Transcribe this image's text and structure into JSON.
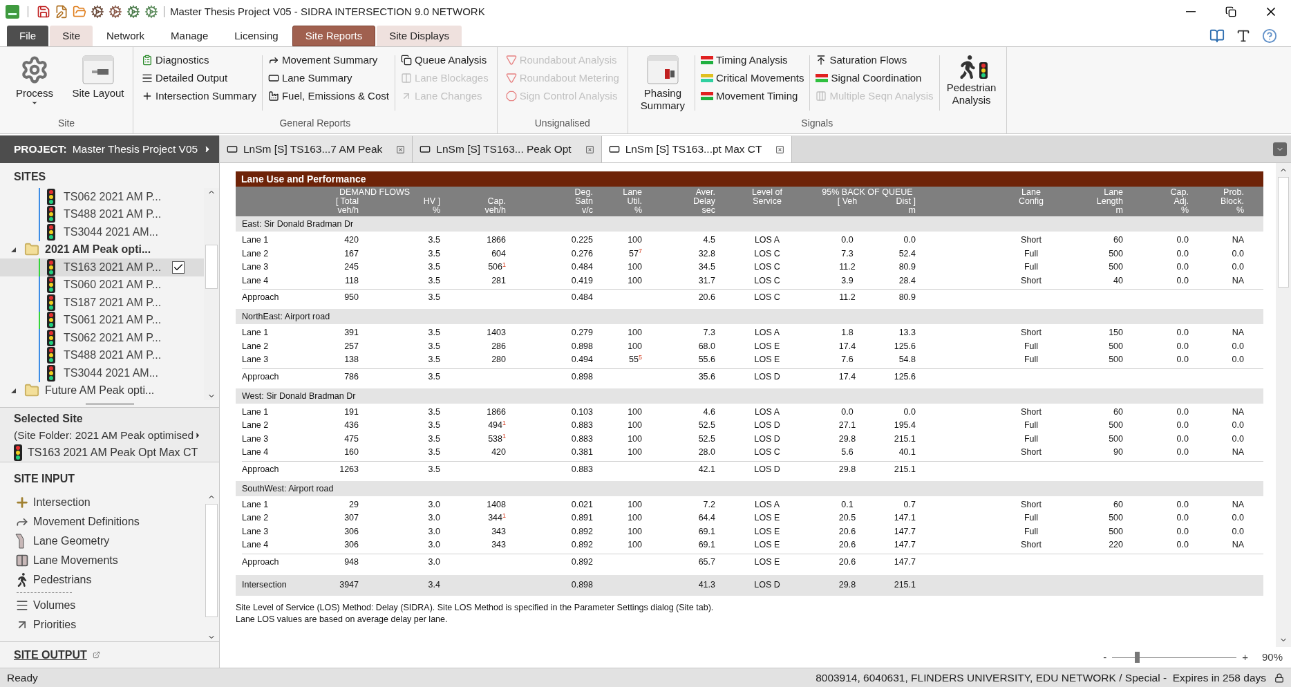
{
  "window": {
    "title": "Master Thesis Project V05 - SIDRA INTERSECTION 9.0 NETWORK"
  },
  "ribbon_tabs": [
    {
      "label": "File",
      "kind": "file",
      "selected": false
    },
    {
      "label": "Site",
      "kind": "contextual",
      "selected": false
    },
    {
      "label": "Network",
      "kind": "plain",
      "selected": false
    },
    {
      "label": "Manage",
      "kind": "plain",
      "selected": false
    },
    {
      "label": "Licensing",
      "kind": "plain",
      "selected": false
    },
    {
      "label": "Site Reports",
      "kind": "contextual",
      "selected": true
    },
    {
      "label": "Site Displays",
      "kind": "contextual",
      "selected": false
    }
  ],
  "ribbon_groups": [
    {
      "label": "Site",
      "entries": [
        {
          "kind": "large",
          "label": "Process",
          "dropdown": true,
          "disabled": false
        },
        {
          "kind": "large",
          "label": "Site Layout",
          "dropdown": false,
          "disabled": false
        }
      ]
    },
    {
      "label": "General Reports",
      "entries": [
        {
          "kind": "stack",
          "items": [
            {
              "label": "Diagnostics",
              "disabled": false
            },
            {
              "label": "Detailed Output",
              "disabled": false
            },
            {
              "label": "Intersection Summary",
              "disabled": false
            }
          ]
        },
        {
          "kind": "stack",
          "items": [
            {
              "label": "Movement Summary",
              "disabled": false
            },
            {
              "label": "Lane Summary",
              "disabled": false
            },
            {
              "label": "Fuel, Emissions & Cost",
              "disabled": false
            }
          ]
        },
        {
          "kind": "stack",
          "items": [
            {
              "label": "Queue Analysis",
              "disabled": false
            },
            {
              "label": "Lane Blockages",
              "disabled": true
            },
            {
              "label": "Lane Changes",
              "disabled": true
            }
          ]
        }
      ]
    },
    {
      "label": "Unsignalised",
      "entries": [
        {
          "kind": "stack",
          "items": [
            {
              "label": "Roundabout Analysis",
              "disabled": true
            },
            {
              "label": "Roundabout Metering",
              "disabled": true
            },
            {
              "label": "Sign Control Analysis",
              "disabled": true
            }
          ]
        }
      ]
    },
    {
      "label": "Signals",
      "entries": [
        {
          "kind": "large",
          "label": "Phasing Summary",
          "dropdown": false,
          "disabled": false
        },
        {
          "kind": "stack",
          "items": [
            {
              "label": "Timing Analysis",
              "disabled": false
            },
            {
              "label": "Critical Movements",
              "disabled": false
            },
            {
              "label": "Movement Timing",
              "disabled": false
            }
          ]
        },
        {
          "kind": "stack",
          "items": [
            {
              "label": "Saturation Flows",
              "disabled": false
            },
            {
              "label": "Signal Coordination",
              "disabled": false
            },
            {
              "label": "Multiple Seqn Analysis",
              "disabled": true
            }
          ]
        },
        {
          "kind": "large",
          "label": "Pedestrian Analysis",
          "dropdown": false,
          "disabled": false
        }
      ]
    }
  ],
  "project": {
    "label": "PROJECT:",
    "name": "Master Thesis Project V05"
  },
  "sites": {
    "title": "SITES",
    "items": [
      {
        "kind": "site",
        "label": "TS062 2021 AM P...",
        "color": "#3c8ce6",
        "selected": false
      },
      {
        "kind": "site",
        "label": "TS488 2021 AM P...",
        "color": "#3c8ce6",
        "selected": false
      },
      {
        "kind": "site",
        "label": "TS3044 2021 AM...",
        "color": "#3c8ce6",
        "selected": false
      },
      {
        "kind": "folder",
        "label": "2021 AM Peak opti...",
        "expanded": true,
        "active": true,
        "children": [
          {
            "kind": "site",
            "label": "TS163 2021 AM P...",
            "color": "#35d43a",
            "selected": true
          },
          {
            "kind": "site",
            "label": "TS060 2021 AM P...",
            "color": "#3c8ce6",
            "selected": false
          },
          {
            "kind": "site",
            "label": "TS187 2021 AM P...",
            "color": "#3c8ce6",
            "selected": false
          },
          {
            "kind": "site",
            "label": "TS061 2021 AM P...",
            "color": "#35d43a",
            "selected": false
          },
          {
            "kind": "site",
            "label": "TS062 2021 AM P...",
            "color": "#3c8ce6",
            "selected": false
          },
          {
            "kind": "site",
            "label": "TS488 2021 AM P...",
            "color": "#3c8ce6",
            "selected": false
          },
          {
            "kind": "site",
            "label": "TS3044 2021 AM...",
            "color": "#3c8ce6",
            "selected": false
          }
        ]
      },
      {
        "kind": "folder",
        "label": "Future AM Peak opti...",
        "expanded": true,
        "active": false
      }
    ]
  },
  "selected_site": {
    "title": "Selected Site",
    "folder": "(Site Folder: 2021 AM Peak optimised",
    "site": "TS163 2021 AM Peak Opt Max CT"
  },
  "site_input": {
    "title": "SITE INPUT",
    "items": [
      {
        "kind": "item",
        "label": "Intersection"
      },
      {
        "kind": "item",
        "label": "Movement Definitions"
      },
      {
        "kind": "item",
        "label": "Lane Geometry"
      },
      {
        "kind": "item",
        "label": "Lane Movements"
      },
      {
        "kind": "item",
        "label": "Pedestrians"
      },
      {
        "kind": "separator"
      },
      {
        "kind": "item",
        "label": "Volumes"
      },
      {
        "kind": "item",
        "label": "Priorities"
      }
    ]
  },
  "site_output": {
    "label": "SITE OUTPUT"
  },
  "document_tabs": [
    {
      "label": "LnSm [S] TS163...7 AM Peak",
      "selected": false
    },
    {
      "label": "LnSm [S] TS163... Peak Opt",
      "selected": false
    },
    {
      "label": "LnSm [S] TS163...pt Max CT",
      "selected": true
    }
  ],
  "report": {
    "title": "Lane Use and Performance",
    "header": [
      {
        "kind": "column"
      },
      {
        "kind": "group",
        "label": "DEMAND FLOWS",
        "columns": [
          {
            "mid": "[ Total",
            "bottom": "veh/h"
          },
          {
            "mid": "HV ]",
            "bottom": "%"
          }
        ]
      },
      {
        "kind": "column",
        "mid": "Cap.",
        "bottom": "veh/h"
      },
      {
        "kind": "column",
        "top": "Deg.",
        "mid": "Satn",
        "bottom": "v/c"
      },
      {
        "kind": "column",
        "top": "Lane",
        "mid": "Util.",
        "bottom": "%"
      },
      {
        "kind": "column",
        "top": "Aver.",
        "mid": "Delay",
        "bottom": "sec"
      },
      {
        "kind": "column",
        "top": "Level of",
        "mid": "Service"
      },
      {
        "kind": "group",
        "label": "95% BACK OF QUEUE",
        "columns": [
          {
            "mid": "[ Veh"
          },
          {
            "mid": "Dist ]",
            "bottom": "m"
          }
        ]
      },
      {
        "kind": "column",
        "top": "Lane",
        "mid": "Config"
      },
      {
        "kind": "column",
        "top": "Lane",
        "mid": "Length",
        "bottom": "m"
      },
      {
        "kind": "column",
        "top": "Cap.",
        "mid": "Adj.",
        "bottom": "%"
      },
      {
        "kind": "column",
        "top": "Prob.",
        "mid": "Block.",
        "bottom": "%"
      }
    ],
    "sections": [
      {
        "title": "East: Sir Donald Bradman Dr",
        "rows": [
          {
            "kind": "lane",
            "cells": [
              "Lane 1",
              "420",
              "3.5",
              "1866",
              "0.225",
              "100",
              "4.5",
              "LOS A",
              "0.0",
              "0.0",
              "Short",
              "60",
              "0.0",
              "NA"
            ]
          },
          {
            "kind": "lane",
            "cells": [
              "Lane 2",
              "167",
              "3.5",
              "604",
              "0.276",
              "57$^{7}$",
              "32.8",
              "LOS C",
              "7.3",
              "52.4",
              "Full",
              "500",
              "0.0",
              "0.0"
            ]
          },
          {
            "kind": "lane",
            "cells": [
              "Lane 3",
              "245",
              "3.5",
              "506$^{1}$",
              "0.484",
              "100",
              "34.5",
              "LOS C",
              "11.2",
              "80.9",
              "Full",
              "500",
              "0.0",
              "0.0"
            ]
          },
          {
            "kind": "lane",
            "cells": [
              "Lane 4",
              "118",
              "3.5",
              "281",
              "0.419",
              "100",
              "31.7",
              "LOS C",
              "3.9",
              "28.4",
              "Short",
              "40",
              "0.0",
              "NA"
            ]
          },
          {
            "kind": "approach",
            "cells": [
              "Approach",
              "950",
              "3.5",
              null,
              "0.484",
              null,
              "20.6",
              "LOS C",
              "11.2",
              "80.9"
            ]
          }
        ]
      },
      {
        "title": "NorthEast: Airport road",
        "rows": [
          {
            "kind": "lane",
            "cells": [
              "Lane 1",
              "391",
              "3.5",
              "1403",
              "0.279",
              "100",
              "7.3",
              "LOS A",
              "1.8",
              "13.3",
              "Short",
              "150",
              "0.0",
              "NA"
            ]
          },
          {
            "kind": "lane",
            "cells": [
              "Lane 2",
              "257",
              "3.5",
              "286",
              "0.898",
              "100",
              "68.0",
              "LOS E",
              "17.4",
              "125.6",
              "Full",
              "500",
              "0.0",
              "0.0"
            ]
          },
          {
            "kind": "lane",
            "cells": [
              "Lane 3",
              "138",
              "3.5",
              "280",
              "0.494",
              "55$^{5}$",
              "55.6",
              "LOS E",
              "7.6",
              "54.8",
              "Full",
              "500",
              "0.0",
              "0.0"
            ]
          },
          {
            "kind": "approach",
            "cells": [
              "Approach",
              "786",
              "3.5",
              null,
              "0.898",
              null,
              "35.6",
              "LOS D",
              "17.4",
              "125.6"
            ]
          }
        ]
      },
      {
        "title": "West: Sir Donald Bradman Dr",
        "rows": [
          {
            "kind": "lane",
            "cells": [
              "Lane 1",
              "191",
              "3.5",
              "1866",
              "0.103",
              "100",
              "4.6",
              "LOS A",
              "0.0",
              "0.0",
              "Short",
              "60",
              "0.0",
              "NA"
            ]
          },
          {
            "kind": "lane",
            "cells": [
              "Lane 2",
              "436",
              "3.5",
              "494$^{1}$",
              "0.883",
              "100",
              "52.5",
              "LOS D",
              "27.1",
              "195.4",
              "Full",
              "500",
              "0.0",
              "0.0"
            ]
          },
          {
            "kind": "lane",
            "cells": [
              "Lane 3",
              "475",
              "3.5",
              "538$^{1}$",
              "0.883",
              "100",
              "52.5",
              "LOS D",
              "29.8",
              "215.1",
              "Full",
              "500",
              "0.0",
              "0.0"
            ]
          },
          {
            "kind": "lane",
            "cells": [
              "Lane 4",
              "160",
              "3.5",
              "420",
              "0.381",
              "100",
              "28.0",
              "LOS C",
              "5.6",
              "40.1",
              "Short",
              "90",
              "0.0",
              "NA"
            ]
          },
          {
            "kind": "approach",
            "cells": [
              "Approach",
              "1263",
              "3.5",
              null,
              "0.883",
              null,
              "42.1",
              "LOS D",
              "29.8",
              "215.1"
            ]
          }
        ]
      },
      {
        "title": "SouthWest: Airport road",
        "rows": [
          {
            "kind": "lane",
            "cells": [
              "Lane 1",
              "29",
              "3.0",
              "1408",
              "0.021",
              "100",
              "7.2",
              "LOS A",
              "0.1",
              "0.7",
              "Short",
              "60",
              "0.0",
              "NA"
            ]
          },
          {
            "kind": "lane",
            "cells": [
              "Lane 2",
              "307",
              "3.0",
              "344$^{1}$",
              "0.891",
              "100",
              "64.4",
              "LOS E",
              "20.5",
              "147.1",
              "Full",
              "500",
              "0.0",
              "0.0"
            ]
          },
          {
            "kind": "lane",
            "cells": [
              "Lane 3",
              "306",
              "3.0",
              "343",
              "0.892",
              "100",
              "69.1",
              "LOS E",
              "20.6",
              "147.7",
              "Full",
              "500",
              "0.0",
              "0.0"
            ]
          },
          {
            "kind": "lane",
            "cells": [
              "Lane 4",
              "306",
              "3.0",
              "343",
              "0.892",
              "100",
              "69.1",
              "LOS E",
              "20.6",
              "147.7",
              "Short",
              "220",
              "0.0",
              "NA"
            ]
          },
          {
            "kind": "approach",
            "cells": [
              "Approach",
              "948",
              "3.0",
              null,
              "0.892",
              null,
              "65.7",
              "LOS E",
              "20.6",
              "147.7"
            ]
          }
        ]
      }
    ],
    "total": {
      "cells": [
        "Intersection",
        "3947",
        "3.4",
        null,
        "0.898",
        null,
        "41.3",
        "LOS D",
        "29.8",
        "215.1"
      ]
    },
    "notes": [
      "Site Level of Service (LOS) Method: Delay (SIDRA). Site LOS Method is specified in the Parameter Settings dialog (Site tab).",
      "Lane LOS values are based on average delay per lane."
    ]
  },
  "zoom": {
    "minus": "-",
    "plus": "+",
    "level": 0.2,
    "reading": "90%"
  },
  "status_bar": {
    "left": "Ready",
    "right": "8003914, 6040631, FLINDERS UNIVERSITY, EDU NETWORK / Special -  Expires in 258 days"
  }
}
